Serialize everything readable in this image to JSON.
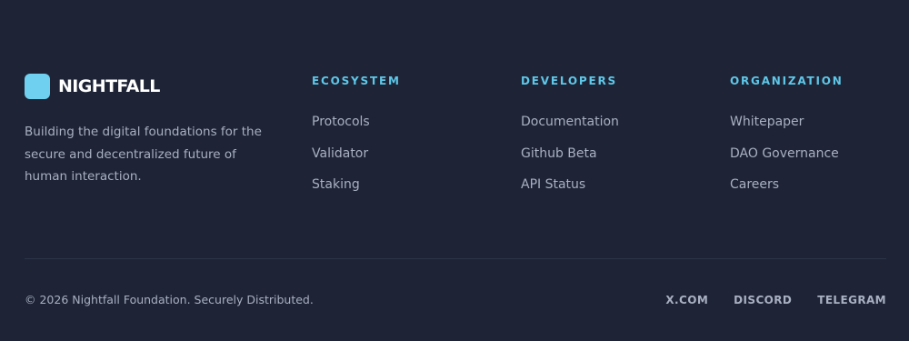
{
  "brand": {
    "name": "NIGHTFALL",
    "tagline": "Building the digital foundations for the secure and decentralized future of human interaction.",
    "accent_color": "#6fd0ef"
  },
  "columns": [
    {
      "title": "ECOSYSTEM",
      "links": [
        "Protocols",
        "Validator",
        "Staking"
      ]
    },
    {
      "title": "DEVELOPERS",
      "links": [
        "Documentation",
        "Github Beta",
        "API Status"
      ]
    },
    {
      "title": "ORGANIZATION",
      "links": [
        "Whitepaper",
        "DAO Governance",
        "Careers"
      ]
    }
  ],
  "bottom": {
    "copyright": "© 2026 Nightfall Foundation. Securely Distributed.",
    "social": [
      "X.COM",
      "DISCORD",
      "TELEGRAM"
    ]
  },
  "colors": {
    "background": "#1e2436",
    "heading": "#5ec7e8",
    "text": "#a9b0c2"
  }
}
